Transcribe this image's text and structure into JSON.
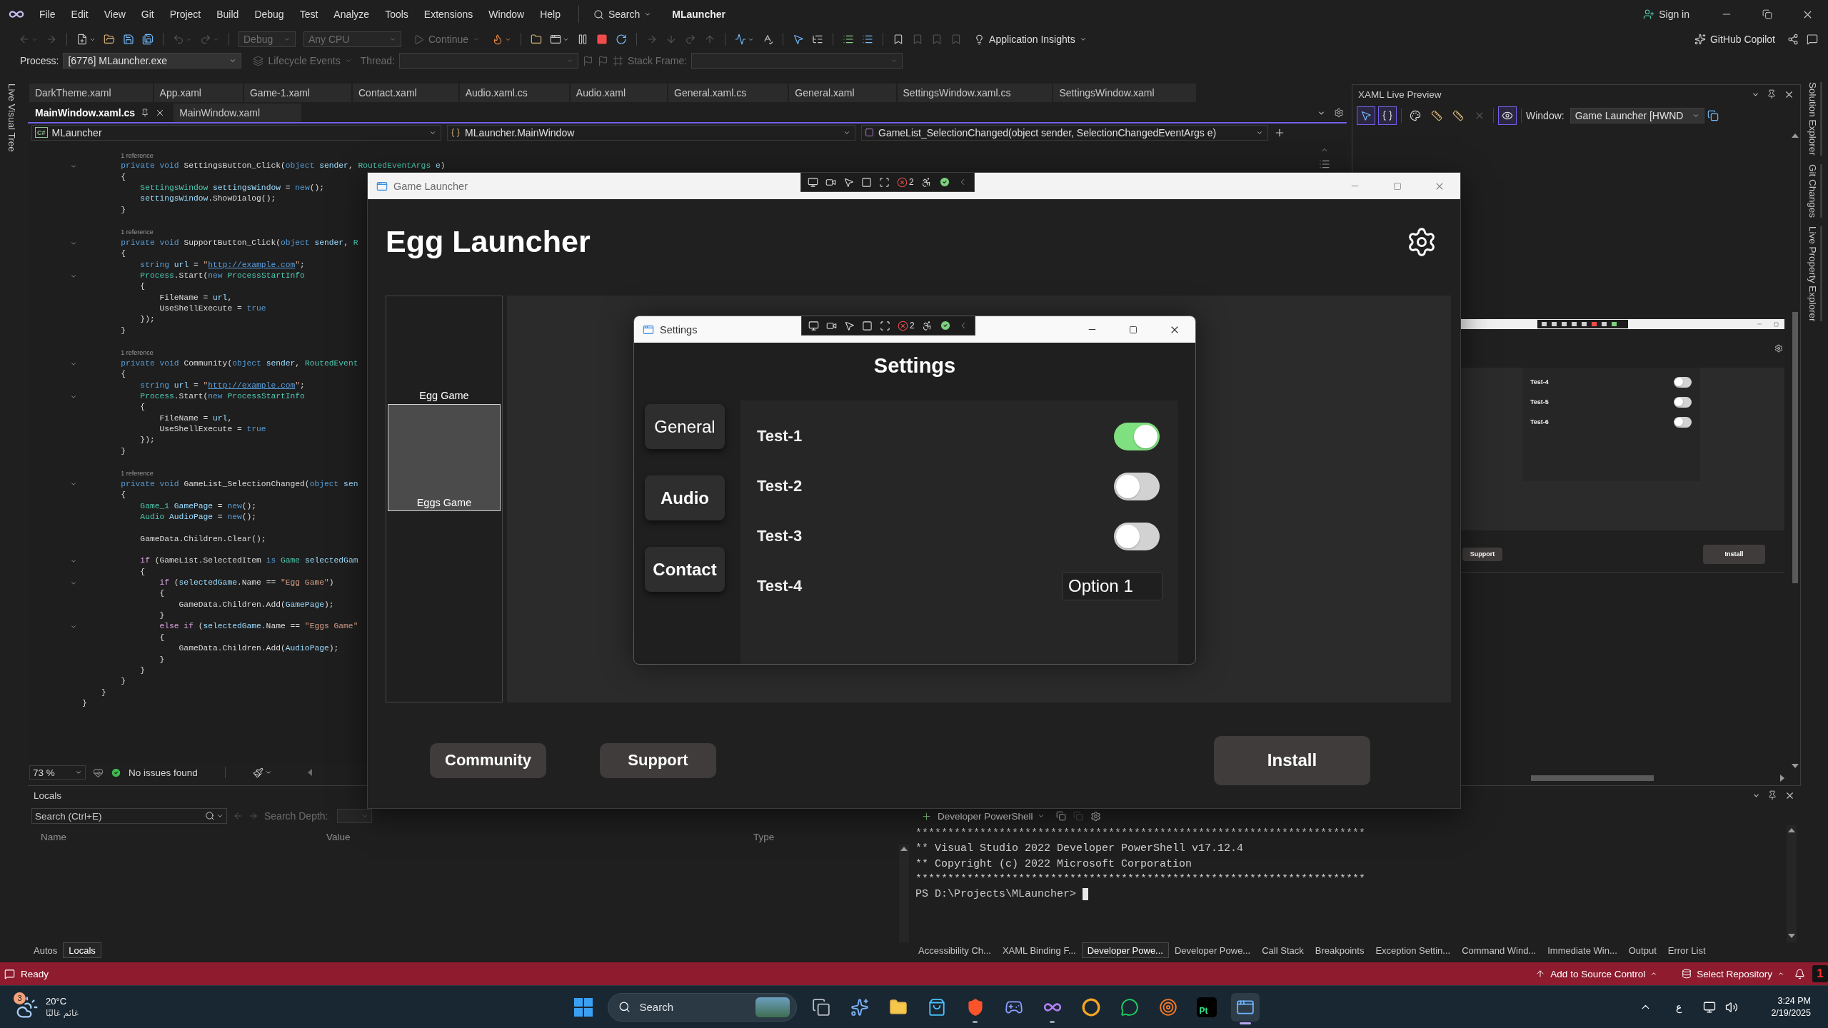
{
  "title_bar": {
    "menu": [
      "File",
      "Edit",
      "View",
      "Git",
      "Project",
      "Build",
      "Debug",
      "Test",
      "Analyze",
      "Tools",
      "Extensions",
      "Window",
      "Help"
    ],
    "search": "Search",
    "solution": "MLauncher",
    "sign_in": "Sign in"
  },
  "standard_toolbar": {
    "tools": [
      {
        "kind": "back",
        "disabled": true
      },
      {
        "kind": "forward",
        "disabled": true
      },
      {
        "kind": "separator"
      },
      {
        "kind": "new_item",
        "disabled": false
      },
      {
        "kind": "open",
        "disabled": false
      },
      {
        "kind": "save",
        "disabled": false
      },
      {
        "kind": "save_all",
        "disabled": false
      },
      {
        "kind": "separator"
      },
      {
        "kind": "undo",
        "disabled": true
      },
      {
        "kind": "redo",
        "disabled": true
      },
      {
        "kind": "separator"
      },
      {
        "kind": "configuration",
        "label": "Debug",
        "disabled": true
      },
      {
        "kind": "platform",
        "label": "Any CPU",
        "disabled": true
      },
      {
        "kind": "continue",
        "label": "Continue",
        "disabled": true
      },
      {
        "kind": "hot_reload",
        "disabled": false
      },
      {
        "kind": "separator"
      },
      {
        "kind": "find",
        "disabled": false
      },
      {
        "kind": "browser",
        "disabled": false
      },
      {
        "kind": "pause",
        "disabled": false
      },
      {
        "kind": "stop",
        "disabled": false
      },
      {
        "kind": "restart",
        "disabled": false
      },
      {
        "kind": "separator"
      },
      {
        "kind": "show_next",
        "disabled": true
      },
      {
        "kind": "step_into",
        "disabled": true
      },
      {
        "kind": "step_over",
        "disabled": true
      },
      {
        "kind": "step_out",
        "disabled": true
      },
      {
        "kind": "separator"
      },
      {
        "kind": "diagnostics",
        "disabled": false
      },
      {
        "kind": "spelling",
        "disabled": false
      },
      {
        "kind": "separator"
      },
      {
        "kind": "select_element",
        "disabled": false
      },
      {
        "kind": "tree",
        "disabled": false
      },
      {
        "kind": "separator"
      },
      {
        "kind": "comment",
        "disabled": false
      },
      {
        "kind": "uncomment",
        "disabled": false
      },
      {
        "kind": "separator"
      },
      {
        "kind": "bookmark",
        "disabled": false
      },
      {
        "kind": "bookmark",
        "disabled": true
      },
      {
        "kind": "bookmark",
        "disabled": true
      },
      {
        "kind": "bookmark",
        "disabled": true
      },
      {
        "kind": "insights",
        "label": "Application Insights",
        "disabled": false
      }
    ],
    "copilot": "GitHub Copilot"
  },
  "debug_location": {
    "process_label": "Process:",
    "process": "[6776] MLauncher.exe",
    "lifecycle": {
      "label": "Lifecycle Events",
      "disabled": true
    },
    "thread": {
      "label": "Thread:",
      "disabled": true
    },
    "stack_frame": {
      "label": "Stack Frame:",
      "disabled": true
    }
  },
  "left_tool_tabs": [
    "Live Visual Tree"
  ],
  "right_tool_tabs": [
    "Solution Explorer",
    "Git Changes",
    "Live Property Explorer"
  ],
  "document_tab_rows": [
    {
      "tabs": [
        {
          "label": "DarkTheme.xaml",
          "selected": false
        },
        {
          "label": "App.xaml",
          "selected": false
        },
        {
          "label": "Game-1.xaml",
          "selected": false
        },
        {
          "label": "Contact.xaml",
          "selected": false
        },
        {
          "label": "Audio.xaml.cs",
          "selected": false
        },
        {
          "label": "Audio.xaml",
          "selected": false
        },
        {
          "label": "General.xaml.cs",
          "selected": false
        },
        {
          "label": "General.xaml",
          "selected": false
        },
        {
          "label": "SettingsWindow.xaml.cs",
          "selected": false
        },
        {
          "label": "SettingsWindow.xaml",
          "selected": false
        }
      ]
    },
    {
      "tabs": [
        {
          "label": "MainWindow.xaml.cs",
          "selected": true
        },
        {
          "label": "MainWindow.xaml",
          "selected": false
        }
      ]
    }
  ],
  "navigation_bar": {
    "project_badge": "C#",
    "project": "MLauncher",
    "type": "MLauncher.MainWindow",
    "member": "GameList_SelectionChanged(object sender, SelectionChangedEventArgs e)"
  },
  "editor": {
    "lines": [
      {
        "kind": "codelens",
        "text": "        1 reference"
      },
      {
        "kind": "code",
        "fold": true,
        "tokens": [
          {
            "kind": "keyword",
            "text": "        private void "
          },
          {
            "kind": "plain",
            "text": "SettingsButton_Click("
          },
          {
            "kind": "keyword",
            "text": "object "
          },
          {
            "kind": "variable",
            "text": "sender"
          },
          {
            "kind": "plain",
            "text": ", "
          },
          {
            "kind": "type",
            "text": "RoutedEventArgs "
          },
          {
            "kind": "variable",
            "text": "e"
          },
          {
            "kind": "plain",
            "text": ")"
          }
        ]
      },
      {
        "kind": "code",
        "fold": false,
        "tokens": [
          {
            "kind": "plain",
            "text": "        {"
          }
        ]
      },
      {
        "kind": "code",
        "fold": false,
        "tokens": [
          {
            "kind": "type",
            "text": "            SettingsWindow "
          },
          {
            "kind": "variable",
            "text": "settingsWindow"
          },
          {
            "kind": "plain",
            "text": " = "
          },
          {
            "kind": "keyword",
            "text": "new"
          },
          {
            "kind": "plain",
            "text": "();"
          }
        ]
      },
      {
        "kind": "code",
        "fold": false,
        "tokens": [
          {
            "kind": "variable",
            "text": "            settingsWindow"
          },
          {
            "kind": "plain",
            "text": ".ShowDialog();"
          }
        ]
      },
      {
        "kind": "code",
        "fold": false,
        "tokens": [
          {
            "kind": "plain",
            "text": "        }"
          }
        ]
      },
      {
        "kind": "blank"
      },
      {
        "kind": "codelens",
        "text": "        1 reference"
      },
      {
        "kind": "code",
        "fold": true,
        "tokens": [
          {
            "kind": "keyword",
            "text": "        private void "
          },
          {
            "kind": "plain",
            "text": "SupportButton_Click("
          },
          {
            "kind": "keyword",
            "text": "object "
          },
          {
            "kind": "variable",
            "text": "sender"
          },
          {
            "kind": "plain",
            "text": ", "
          },
          {
            "kind": "type",
            "text": "R"
          }
        ]
      },
      {
        "kind": "code",
        "fold": false,
        "tokens": [
          {
            "kind": "plain",
            "text": "        {"
          }
        ]
      },
      {
        "kind": "code",
        "fold": false,
        "tokens": [
          {
            "kind": "keyword",
            "text": "            string "
          },
          {
            "kind": "variable",
            "text": "url"
          },
          {
            "kind": "plain",
            "text": " = "
          },
          {
            "kind": "string",
            "text": "\""
          },
          {
            "kind": "link",
            "text": "http://example.com"
          },
          {
            "kind": "string",
            "text": "\""
          },
          {
            "kind": "plain",
            "text": ";"
          }
        ]
      },
      {
        "kind": "code",
        "fold": true,
        "tokens": [
          {
            "kind": "type",
            "text": "            Process"
          },
          {
            "kind": "plain",
            "text": ".Start("
          },
          {
            "kind": "keyword",
            "text": "new "
          },
          {
            "kind": "type",
            "text": "ProcessStartInfo"
          }
        ]
      },
      {
        "kind": "code",
        "fold": false,
        "tokens": [
          {
            "kind": "plain",
            "text": "            {"
          }
        ]
      },
      {
        "kind": "code",
        "fold": false,
        "tokens": [
          {
            "kind": "plain",
            "text": "                FileName = "
          },
          {
            "kind": "variable",
            "text": "url"
          },
          {
            "kind": "plain",
            "text": ","
          }
        ]
      },
      {
        "kind": "code",
        "fold": false,
        "tokens": [
          {
            "kind": "plain",
            "text": "                UseShellExecute = "
          },
          {
            "kind": "keyword",
            "text": "true"
          }
        ]
      },
      {
        "kind": "code",
        "fold": false,
        "tokens": [
          {
            "kind": "plain",
            "text": "            });"
          }
        ]
      },
      {
        "kind": "code",
        "fold": false,
        "tokens": [
          {
            "kind": "plain",
            "text": "        }"
          }
        ]
      },
      {
        "kind": "blank"
      },
      {
        "kind": "codelens",
        "text": "        1 reference"
      },
      {
        "kind": "code",
        "fold": true,
        "tokens": [
          {
            "kind": "keyword",
            "text": "        private void "
          },
          {
            "kind": "plain",
            "text": "Community("
          },
          {
            "kind": "keyword",
            "text": "object "
          },
          {
            "kind": "variable",
            "text": "sender"
          },
          {
            "kind": "plain",
            "text": ", "
          },
          {
            "kind": "type",
            "text": "RoutedEvent"
          }
        ]
      },
      {
        "kind": "code",
        "fold": false,
        "tokens": [
          {
            "kind": "plain",
            "text": "        {"
          }
        ]
      },
      {
        "kind": "code",
        "fold": false,
        "tokens": [
          {
            "kind": "keyword",
            "text": "            string "
          },
          {
            "kind": "variable",
            "text": "url"
          },
          {
            "kind": "plain",
            "text": " = "
          },
          {
            "kind": "string",
            "text": "\""
          },
          {
            "kind": "link",
            "text": "http://example.com"
          },
          {
            "kind": "string",
            "text": "\""
          },
          {
            "kind": "plain",
            "text": ";"
          }
        ]
      },
      {
        "kind": "code",
        "fold": true,
        "tokens": [
          {
            "kind": "type",
            "text": "            Process"
          },
          {
            "kind": "plain",
            "text": ".Start("
          },
          {
            "kind": "keyword",
            "text": "new "
          },
          {
            "kind": "type",
            "text": "ProcessStartInfo"
          }
        ]
      },
      {
        "kind": "code",
        "fold": false,
        "tokens": [
          {
            "kind": "plain",
            "text": "            {"
          }
        ]
      },
      {
        "kind": "code",
        "fold": false,
        "tokens": [
          {
            "kind": "plain",
            "text": "                FileName = "
          },
          {
            "kind": "variable",
            "text": "url"
          },
          {
            "kind": "plain",
            "text": ","
          }
        ]
      },
      {
        "kind": "code",
        "fold": false,
        "tokens": [
          {
            "kind": "plain",
            "text": "                UseShellExecute = "
          },
          {
            "kind": "keyword",
            "text": "true"
          }
        ]
      },
      {
        "kind": "code",
        "fold": false,
        "tokens": [
          {
            "kind": "plain",
            "text": "            });"
          }
        ]
      },
      {
        "kind": "code",
        "fold": false,
        "tokens": [
          {
            "kind": "plain",
            "text": "        }"
          }
        ]
      },
      {
        "kind": "blank"
      },
      {
        "kind": "codelens",
        "text": "        1 reference"
      },
      {
        "kind": "code",
        "fold": true,
        "tokens": [
          {
            "kind": "keyword",
            "text": "        private void "
          },
          {
            "kind": "plain",
            "text": "GameList_SelectionChanged("
          },
          {
            "kind": "keyword",
            "text": "object "
          },
          {
            "kind": "variable",
            "text": "sen"
          }
        ]
      },
      {
        "kind": "code",
        "fold": false,
        "tokens": [
          {
            "kind": "plain",
            "text": "        {"
          }
        ]
      },
      {
        "kind": "code",
        "fold": false,
        "tokens": [
          {
            "kind": "type",
            "text": "            Game_1 "
          },
          {
            "kind": "variable",
            "text": "GamePage"
          },
          {
            "kind": "plain",
            "text": " = "
          },
          {
            "kind": "keyword",
            "text": "new"
          },
          {
            "kind": "plain",
            "text": "();"
          }
        ]
      },
      {
        "kind": "code",
        "fold": false,
        "tokens": [
          {
            "kind": "type",
            "text": "            Audio "
          },
          {
            "kind": "variable",
            "text": "AudioPage"
          },
          {
            "kind": "plain",
            "text": " = "
          },
          {
            "kind": "keyword",
            "text": "new"
          },
          {
            "kind": "plain",
            "text": "();"
          }
        ]
      },
      {
        "kind": "blank"
      },
      {
        "kind": "code",
        "fold": false,
        "tokens": [
          {
            "kind": "plain",
            "text": "            GameData.Children.Clear();"
          }
        ]
      },
      {
        "kind": "blank"
      },
      {
        "kind": "code",
        "fold": true,
        "tokens": [
          {
            "kind": "control",
            "text": "            if "
          },
          {
            "kind": "plain",
            "text": "(GameList.SelectedItem "
          },
          {
            "kind": "keyword",
            "text": "is "
          },
          {
            "kind": "type",
            "text": "Game "
          },
          {
            "kind": "variable",
            "text": "selectedGam"
          }
        ]
      },
      {
        "kind": "code",
        "fold": false,
        "tokens": [
          {
            "kind": "plain",
            "text": "            {"
          }
        ]
      },
      {
        "kind": "code",
        "fold": true,
        "tokens": [
          {
            "kind": "control",
            "text": "                if "
          },
          {
            "kind": "plain",
            "text": "("
          },
          {
            "kind": "variable",
            "text": "selectedGame"
          },
          {
            "kind": "plain",
            "text": ".Name == "
          },
          {
            "kind": "string",
            "text": "\"Egg Game\""
          },
          {
            "kind": "plain",
            "text": ")"
          }
        ]
      },
      {
        "kind": "code",
        "fold": false,
        "tokens": [
          {
            "kind": "plain",
            "text": "                {"
          }
        ]
      },
      {
        "kind": "code",
        "fold": false,
        "tokens": [
          {
            "kind": "plain",
            "text": "                    GameData.Children.Add("
          },
          {
            "kind": "variable",
            "text": "GamePage"
          },
          {
            "kind": "plain",
            "text": ");"
          }
        ]
      },
      {
        "kind": "code",
        "fold": false,
        "tokens": [
          {
            "kind": "plain",
            "text": "                }"
          }
        ]
      },
      {
        "kind": "code",
        "fold": true,
        "tokens": [
          {
            "kind": "control",
            "text": "                else if "
          },
          {
            "kind": "plain",
            "text": "("
          },
          {
            "kind": "variable",
            "text": "selectedGame"
          },
          {
            "kind": "plain",
            "text": ".Name == "
          },
          {
            "kind": "string",
            "text": "\"Eggs Game\""
          }
        ]
      },
      {
        "kind": "code",
        "fold": false,
        "tokens": [
          {
            "kind": "plain",
            "text": "                {"
          }
        ]
      },
      {
        "kind": "code",
        "fold": false,
        "tokens": [
          {
            "kind": "plain",
            "text": "                    GameData.Children.Add("
          },
          {
            "kind": "variable",
            "text": "AudioPage"
          },
          {
            "kind": "plain",
            "text": ");"
          }
        ]
      },
      {
        "kind": "code",
        "fold": false,
        "tokens": [
          {
            "kind": "plain",
            "text": "                }"
          }
        ]
      },
      {
        "kind": "code",
        "fold": false,
        "tokens": [
          {
            "kind": "plain",
            "text": "            }"
          }
        ]
      },
      {
        "kind": "code",
        "fold": false,
        "tokens": [
          {
            "kind": "plain",
            "text": "        }"
          }
        ]
      },
      {
        "kind": "code",
        "fold": false,
        "tokens": [
          {
            "kind": "plain",
            "text": "    }"
          }
        ]
      },
      {
        "kind": "code",
        "fold": false,
        "tokens": [
          {
            "kind": "plain",
            "text": "}"
          }
        ]
      }
    ],
    "zoom": "73 %",
    "issues": "No issues found"
  },
  "game_launcher": {
    "title": "Game Launcher",
    "toolbar_badge": "2",
    "heading": "Egg Launcher",
    "games": [
      {
        "name": "Egg Game",
        "selected": false
      },
      {
        "name": "Eggs Game",
        "selected": true
      }
    ],
    "buttons": [
      {
        "label": "Community",
        "kind": "secondary"
      },
      {
        "label": "Support",
        "kind": "secondary"
      },
      {
        "label": "Install",
        "kind": "primary"
      }
    ],
    "settings": {
      "title": "Settings",
      "toolbar_badge": "2",
      "heading": "Settings",
      "nav": [
        {
          "label": "General",
          "selected": true
        },
        {
          "label": "Audio",
          "selected": false
        },
        {
          "label": "Contact",
          "selected": false
        }
      ],
      "options": [
        {
          "kind": "toggle",
          "label": "Test-1",
          "on": true
        },
        {
          "kind": "toggle",
          "label": "Test-2",
          "on": false
        },
        {
          "kind": "toggle",
          "label": "Test-3",
          "on": false
        },
        {
          "kind": "dropdown",
          "label": "Test-4",
          "value": "Option 1"
        }
      ]
    }
  },
  "xaml_live_preview": {
    "title": "XAML Live Preview",
    "tools": [
      {
        "kind": "select",
        "on": true,
        "disabled": false
      },
      {
        "kind": "adorners",
        "on": true,
        "disabled": false
      },
      {
        "kind": "colors",
        "on": false,
        "disabled": false
      },
      {
        "kind": "ruler_add",
        "on": false,
        "disabled": false
      },
      {
        "kind": "rulers",
        "on": false,
        "disabled": false
      },
      {
        "kind": "clear",
        "on": false,
        "disabled": true
      },
      {
        "kind": "preview",
        "on": true,
        "disabled": false
      }
    ],
    "window_label": "Window:",
    "window": "Game Launcher [HWND",
    "preview": {
      "options": [
        {
          "label": "Test-4",
          "on": false
        },
        {
          "label": "Test-5",
          "on": false
        },
        {
          "label": "Test-6",
          "on": false
        }
      ],
      "buttons": [
        {
          "label": "Support",
          "kind": "secondary"
        },
        {
          "label": "Install",
          "kind": "primary"
        }
      ]
    }
  },
  "locals": {
    "title": "Locals",
    "search": {
      "placeholder": "Search (Ctrl+E)"
    },
    "depth_label": "Search Depth:",
    "columns": [
      "Name",
      "Value",
      "Type"
    ],
    "tabs": [
      {
        "label": "Autos",
        "selected": false
      },
      {
        "label": "Locals",
        "selected": true
      }
    ]
  },
  "terminal": {
    "profile": "Developer PowerShell",
    "lines": [
      "**********************************************************************",
      "** Visual Studio 2022 Developer PowerShell v17.12.4",
      "** Copyright (c) 2022 Microsoft Corporation",
      "**********************************************************************"
    ],
    "prompt": "PS D:\\Projects\\MLauncher>",
    "tabs": [
      {
        "label": "Accessibility Ch...",
        "selected": false
      },
      {
        "label": "XAML Binding F...",
        "selected": false
      },
      {
        "label": "Developer Powe...",
        "selected": true
      },
      {
        "label": "Developer Powe...",
        "selected": false
      },
      {
        "label": "Call Stack",
        "selected": false
      },
      {
        "label": "Breakpoints",
        "selected": false
      },
      {
        "label": "Exception Settin...",
        "selected": false
      },
      {
        "label": "Command Wind...",
        "selected": false
      },
      {
        "label": "Immediate Win...",
        "selected": false
      },
      {
        "label": "Output",
        "selected": false
      },
      {
        "label": "Error List",
        "selected": false
      }
    ]
  },
  "status_bar": {
    "message": "Ready",
    "source_control": "Add to Source Control",
    "repository": "Select Repository",
    "notifications": "1"
  },
  "taskbar": {
    "weather": {
      "badge": "3",
      "temperature": "20°C",
      "condition": "غائم غالبًا"
    },
    "search": {
      "placeholder": "Search"
    },
    "apps": [
      {
        "kind": "task_view",
        "running": false,
        "active": false
      },
      {
        "kind": "copilot",
        "running": false,
        "active": false
      },
      {
        "kind": "folder",
        "running": false,
        "active": false
      },
      {
        "kind": "store",
        "running": false,
        "active": false
      },
      {
        "kind": "browser",
        "running": true,
        "active": false
      },
      {
        "kind": "chat",
        "running": false,
        "active": false
      },
      {
        "kind": "ide",
        "running": true,
        "active": false
      },
      {
        "kind": "ring",
        "running": false,
        "active": false
      },
      {
        "kind": "messenger",
        "running": false,
        "active": false
      },
      {
        "kind": "blender",
        "running": false,
        "active": false
      },
      {
        "kind": "tile",
        "label": "Pt",
        "running": false,
        "active": false
      },
      {
        "kind": "window",
        "running": true,
        "active": true
      }
    ],
    "language": "ع",
    "time": "3:24 PM",
    "date": "2/19/2025"
  }
}
